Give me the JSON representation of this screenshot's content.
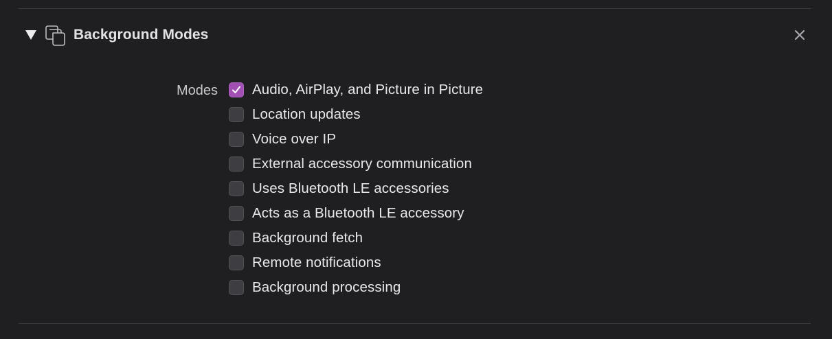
{
  "section": {
    "title": "Background Modes",
    "expanded": true,
    "icon": "background-modes-icon",
    "close_icon": "close-icon"
  },
  "modes": {
    "label": "Modes",
    "options": [
      {
        "label": "Audio, AirPlay, and Picture in Picture",
        "checked": true
      },
      {
        "label": "Location updates",
        "checked": false
      },
      {
        "label": "Voice over IP",
        "checked": false
      },
      {
        "label": "External accessory communication",
        "checked": false
      },
      {
        "label": "Uses Bluetooth LE accessories",
        "checked": false
      },
      {
        "label": "Acts as a Bluetooth LE accessory",
        "checked": false
      },
      {
        "label": "Background fetch",
        "checked": false
      },
      {
        "label": "Remote notifications",
        "checked": false
      },
      {
        "label": "Background processing",
        "checked": false
      }
    ]
  },
  "colors": {
    "background": "#1f1f22",
    "accent": "#a14fb3",
    "text": "#e8e8ea"
  }
}
